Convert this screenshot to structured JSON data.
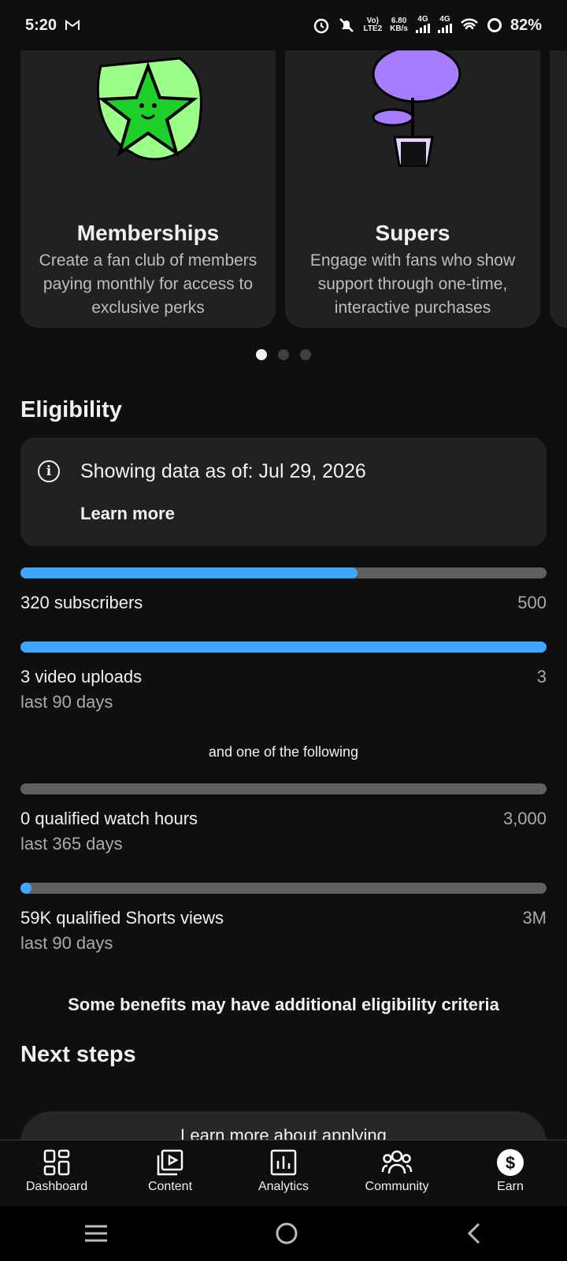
{
  "status_bar": {
    "time": "5:20",
    "network_top": "Vo)",
    "network_bottom": "LTE2",
    "speed_top": "6.80",
    "speed_bottom": "KB/s",
    "sig1": "4G",
    "sig2": "4G",
    "battery": "82%"
  },
  "cards": [
    {
      "title": "Memberships",
      "description": "Create a fan club of members paying monthly for access to exclusive perks",
      "icon": "star-mascot-icon"
    },
    {
      "title": "Supers",
      "description": "Engage with fans who show support through one-time, interactive purchases",
      "icon": "flower-pot-icon"
    }
  ],
  "carousel": {
    "pages": 3,
    "active": 0
  },
  "eligibility": {
    "heading": "Eligibility",
    "info_text": "Showing data as of: Jul 29, 2026",
    "learn_more": "Learn more",
    "requirements": [
      {
        "label": "320 subscribers",
        "sub": "",
        "target": "500",
        "progress": 0.64
      },
      {
        "label": "3 video uploads",
        "sub": "last 90 days",
        "target": "3",
        "progress": 1.0
      }
    ],
    "divider_text": "and one of the following",
    "alternatives": [
      {
        "label": "0 qualified watch hours",
        "sub": "last 365 days",
        "target": "3,000",
        "progress": 0.0
      },
      {
        "label": "59K qualified Shorts views",
        "sub": "last 90 days",
        "target": "3M",
        "progress": 0.02
      }
    ],
    "footnote": "Some benefits may have additional eligibility criteria"
  },
  "next_steps": {
    "heading": "Next steps",
    "button": "Learn more about applying"
  },
  "bottom_nav": [
    {
      "label": "Dashboard",
      "icon": "dashboard-icon"
    },
    {
      "label": "Content",
      "icon": "content-icon"
    },
    {
      "label": "Analytics",
      "icon": "analytics-icon"
    },
    {
      "label": "Community",
      "icon": "community-icon"
    },
    {
      "label": "Earn",
      "icon": "earn-icon"
    }
  ],
  "colors": {
    "accent": "#3ea6ff",
    "background": "#0f0f0f",
    "card": "#212121"
  }
}
